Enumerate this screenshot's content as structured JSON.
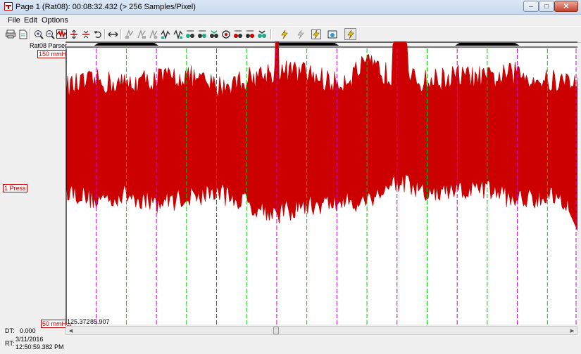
{
  "window": {
    "title": "Page 1 (Rat08): 00:08:32.432    (> 256 Samples/Pixel)",
    "min_glyph": "–",
    "max_glyph": "□",
    "close_glyph": "✕"
  },
  "menu": [
    "File",
    "Edit",
    "Options"
  ],
  "toolbar_icons": [
    "print-icon",
    "page-icon",
    "zoom-in-icon",
    "zoom-out-icon",
    "fit-icon",
    "expand-icon",
    "compress-icon",
    "undo-icon",
    "stretch-icon",
    "tool-a-icon",
    "tool-b-icon",
    "tool-c-icon",
    "tool-d-icon",
    "tool-e-icon",
    "tool-f-icon",
    "tool-g-icon",
    "tool-h-icon",
    "tool-i-icon",
    "tool-j-icon",
    "tool-k-icon",
    "tool-l-icon",
    "lightning-icon",
    "lightning-off-icon",
    "lightning-alt-icon",
    "tile-icon",
    "lightning-active-icon"
  ],
  "channel": {
    "parser_label": "Rat08 Parser",
    "top_scale": "150 mmHg",
    "name": "1  Press",
    "bottom_scale": "50 mmHg",
    "readout_1": "125.372",
    "readout_2": "85.907"
  },
  "status": {
    "dt_label": "DT:",
    "dt_value": "0.000",
    "rt_label": "RT:",
    "rt_date": "3/11/2016",
    "rt_time": "12:50:59.382 PM"
  },
  "chart_data": {
    "type": "area",
    "ylim": [
      50,
      150
    ],
    "x": [
      0,
      1,
      2,
      3,
      4,
      5,
      6,
      7,
      8,
      9,
      10,
      11,
      12,
      13,
      14,
      15,
      16,
      17
    ],
    "series": [
      {
        "upper": [
          136,
          138,
          137,
          139,
          140,
          136,
          139,
          142,
          141,
          137,
          144,
          139,
          138,
          140,
          139,
          141,
          138,
          138
        ],
        "lower": [
          99,
          95,
          97,
          94,
          96,
          98,
          94,
          90,
          93,
          94,
          95,
          102,
          97,
          98,
          99,
          95,
          97,
          94
        ]
      }
    ],
    "spike": {
      "x": 7.0,
      "value": 170
    },
    "peak": {
      "x": 11.1,
      "value": 158
    },
    "dip": {
      "x": 17.0,
      "value": 84
    },
    "dashed_green": [
      2,
      4,
      6,
      8,
      10,
      12,
      14,
      16
    ],
    "dashed_magenta": [
      1,
      3,
      5,
      7,
      9,
      11,
      13,
      15,
      17
    ],
    "bars": [
      [
        1,
        3
      ],
      [
        7,
        9
      ],
      [
        13,
        15
      ]
    ],
    "colors": {
      "fill": "#cc0000",
      "green": "#00cc00",
      "magenta": "#cc00cc",
      "axis": "#000000"
    }
  }
}
